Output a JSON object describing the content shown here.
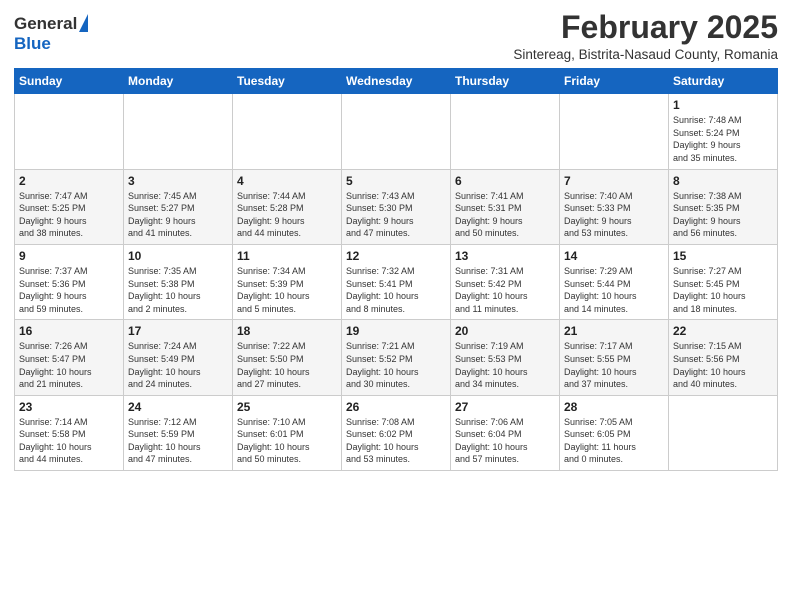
{
  "logo": {
    "general": "General",
    "blue": "Blue"
  },
  "header": {
    "month_year": "February 2025",
    "location": "Sintereag, Bistrita-Nasaud County, Romania"
  },
  "weekdays": [
    "Sunday",
    "Monday",
    "Tuesday",
    "Wednesday",
    "Thursday",
    "Friday",
    "Saturday"
  ],
  "weeks": [
    [
      {
        "day": "",
        "info": ""
      },
      {
        "day": "",
        "info": ""
      },
      {
        "day": "",
        "info": ""
      },
      {
        "day": "",
        "info": ""
      },
      {
        "day": "",
        "info": ""
      },
      {
        "day": "",
        "info": ""
      },
      {
        "day": "1",
        "info": "Sunrise: 7:48 AM\nSunset: 5:24 PM\nDaylight: 9 hours\nand 35 minutes."
      }
    ],
    [
      {
        "day": "2",
        "info": "Sunrise: 7:47 AM\nSunset: 5:25 PM\nDaylight: 9 hours\nand 38 minutes."
      },
      {
        "day": "3",
        "info": "Sunrise: 7:45 AM\nSunset: 5:27 PM\nDaylight: 9 hours\nand 41 minutes."
      },
      {
        "day": "4",
        "info": "Sunrise: 7:44 AM\nSunset: 5:28 PM\nDaylight: 9 hours\nand 44 minutes."
      },
      {
        "day": "5",
        "info": "Sunrise: 7:43 AM\nSunset: 5:30 PM\nDaylight: 9 hours\nand 47 minutes."
      },
      {
        "day": "6",
        "info": "Sunrise: 7:41 AM\nSunset: 5:31 PM\nDaylight: 9 hours\nand 50 minutes."
      },
      {
        "day": "7",
        "info": "Sunrise: 7:40 AM\nSunset: 5:33 PM\nDaylight: 9 hours\nand 53 minutes."
      },
      {
        "day": "8",
        "info": "Sunrise: 7:38 AM\nSunset: 5:35 PM\nDaylight: 9 hours\nand 56 minutes."
      }
    ],
    [
      {
        "day": "9",
        "info": "Sunrise: 7:37 AM\nSunset: 5:36 PM\nDaylight: 9 hours\nand 59 minutes."
      },
      {
        "day": "10",
        "info": "Sunrise: 7:35 AM\nSunset: 5:38 PM\nDaylight: 10 hours\nand 2 minutes."
      },
      {
        "day": "11",
        "info": "Sunrise: 7:34 AM\nSunset: 5:39 PM\nDaylight: 10 hours\nand 5 minutes."
      },
      {
        "day": "12",
        "info": "Sunrise: 7:32 AM\nSunset: 5:41 PM\nDaylight: 10 hours\nand 8 minutes."
      },
      {
        "day": "13",
        "info": "Sunrise: 7:31 AM\nSunset: 5:42 PM\nDaylight: 10 hours\nand 11 minutes."
      },
      {
        "day": "14",
        "info": "Sunrise: 7:29 AM\nSunset: 5:44 PM\nDaylight: 10 hours\nand 14 minutes."
      },
      {
        "day": "15",
        "info": "Sunrise: 7:27 AM\nSunset: 5:45 PM\nDaylight: 10 hours\nand 18 minutes."
      }
    ],
    [
      {
        "day": "16",
        "info": "Sunrise: 7:26 AM\nSunset: 5:47 PM\nDaylight: 10 hours\nand 21 minutes."
      },
      {
        "day": "17",
        "info": "Sunrise: 7:24 AM\nSunset: 5:49 PM\nDaylight: 10 hours\nand 24 minutes."
      },
      {
        "day": "18",
        "info": "Sunrise: 7:22 AM\nSunset: 5:50 PM\nDaylight: 10 hours\nand 27 minutes."
      },
      {
        "day": "19",
        "info": "Sunrise: 7:21 AM\nSunset: 5:52 PM\nDaylight: 10 hours\nand 30 minutes."
      },
      {
        "day": "20",
        "info": "Sunrise: 7:19 AM\nSunset: 5:53 PM\nDaylight: 10 hours\nand 34 minutes."
      },
      {
        "day": "21",
        "info": "Sunrise: 7:17 AM\nSunset: 5:55 PM\nDaylight: 10 hours\nand 37 minutes."
      },
      {
        "day": "22",
        "info": "Sunrise: 7:15 AM\nSunset: 5:56 PM\nDaylight: 10 hours\nand 40 minutes."
      }
    ],
    [
      {
        "day": "23",
        "info": "Sunrise: 7:14 AM\nSunset: 5:58 PM\nDaylight: 10 hours\nand 44 minutes."
      },
      {
        "day": "24",
        "info": "Sunrise: 7:12 AM\nSunset: 5:59 PM\nDaylight: 10 hours\nand 47 minutes."
      },
      {
        "day": "25",
        "info": "Sunrise: 7:10 AM\nSunset: 6:01 PM\nDaylight: 10 hours\nand 50 minutes."
      },
      {
        "day": "26",
        "info": "Sunrise: 7:08 AM\nSunset: 6:02 PM\nDaylight: 10 hours\nand 53 minutes."
      },
      {
        "day": "27",
        "info": "Sunrise: 7:06 AM\nSunset: 6:04 PM\nDaylight: 10 hours\nand 57 minutes."
      },
      {
        "day": "28",
        "info": "Sunrise: 7:05 AM\nSunset: 6:05 PM\nDaylight: 11 hours\nand 0 minutes."
      },
      {
        "day": "",
        "info": ""
      }
    ]
  ]
}
